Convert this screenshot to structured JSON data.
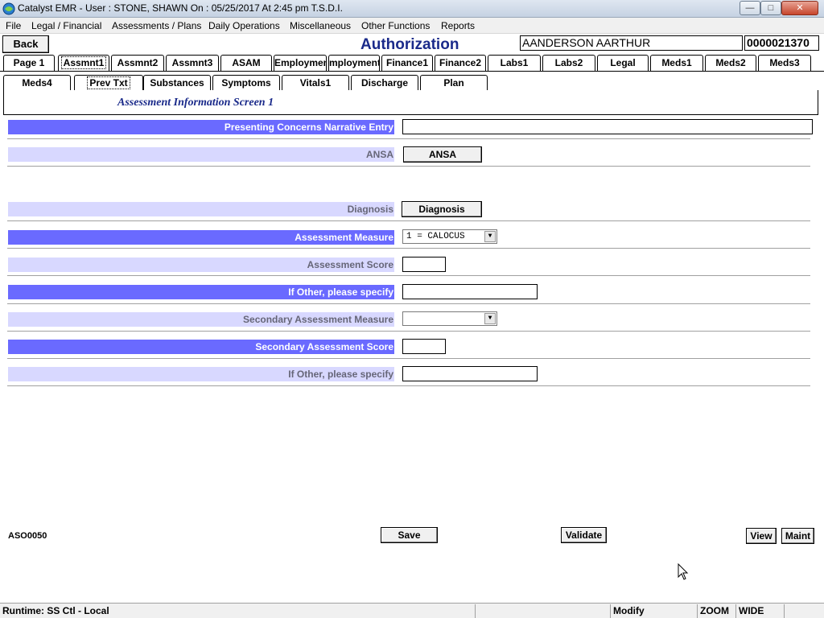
{
  "window": {
    "title": "Catalyst EMR  -  User : STONE, SHAWN On : 05/25/2017 At  2:45 pm  T.S.D.I.",
    "minimize_glyph": "—",
    "maximize_glyph": "□",
    "close_glyph": "✕"
  },
  "menu": [
    "File",
    "Legal / Financial",
    "Assessments / Plans",
    "Daily Operations",
    "Miscellaneous",
    "Other Functions",
    "Reports"
  ],
  "header": {
    "back_label": "Back",
    "page_title": "Authorization",
    "patient_name": "AANDERSON AARTHUR",
    "patient_id": "0000021370"
  },
  "tabs_row1": [
    {
      "label": "Page 1"
    },
    {
      "label": "Assmnt1",
      "active": true
    },
    {
      "label": "Assmnt2"
    },
    {
      "label": "Assmnt3"
    },
    {
      "label": "ASAM"
    },
    {
      "label": "Employment"
    },
    {
      "label": "mployment:"
    },
    {
      "label": "Finance1"
    },
    {
      "label": "Finance2"
    },
    {
      "label": "Labs1"
    },
    {
      "label": "Labs2"
    },
    {
      "label": "Legal"
    },
    {
      "label": "Meds1"
    },
    {
      "label": "Meds2"
    },
    {
      "label": "Meds3"
    }
  ],
  "tabs_row2": [
    {
      "label": "Meds4"
    },
    {
      "label": "Prev Txt",
      "active": true
    },
    {
      "label": "Substances"
    },
    {
      "label": "Symptoms"
    },
    {
      "label": "Vitals1"
    },
    {
      "label": "Discharge"
    },
    {
      "label": "Plan"
    }
  ],
  "screen_subtitle": "Assessment Information Screen 1",
  "form": {
    "presenting_concerns_label": "Presenting Concerns Narrative Entry",
    "presenting_concerns_value": "",
    "ansa_label": "ANSA",
    "ansa_button": "ANSA",
    "diagnosis_label": "Diagnosis",
    "diagnosis_button": "Diagnosis",
    "assessment_measure_label": "Assessment Measure",
    "assessment_measure_value": "1 = CALOCUS",
    "assessment_score_label": "Assessment Score",
    "assessment_score_value": "",
    "other_specify_label": "If Other, please specify",
    "other_specify_value": "",
    "secondary_measure_label": "Secondary Assessment Measure",
    "secondary_measure_value": "",
    "secondary_score_label": "Secondary Assessment Score",
    "secondary_score_value": "",
    "other_specify2_label": "If Other, please specify",
    "other_specify2_value": ""
  },
  "footer": {
    "screen_code": "ASO0050",
    "save_label": "Save",
    "validate_label": "Validate",
    "view_label": "View",
    "maint_label": "Maint"
  },
  "statusbar": {
    "runtime": "Runtime: SS Ctl - Local",
    "mode": "Modify",
    "zoom": "ZOOM",
    "wide": "WIDE"
  }
}
